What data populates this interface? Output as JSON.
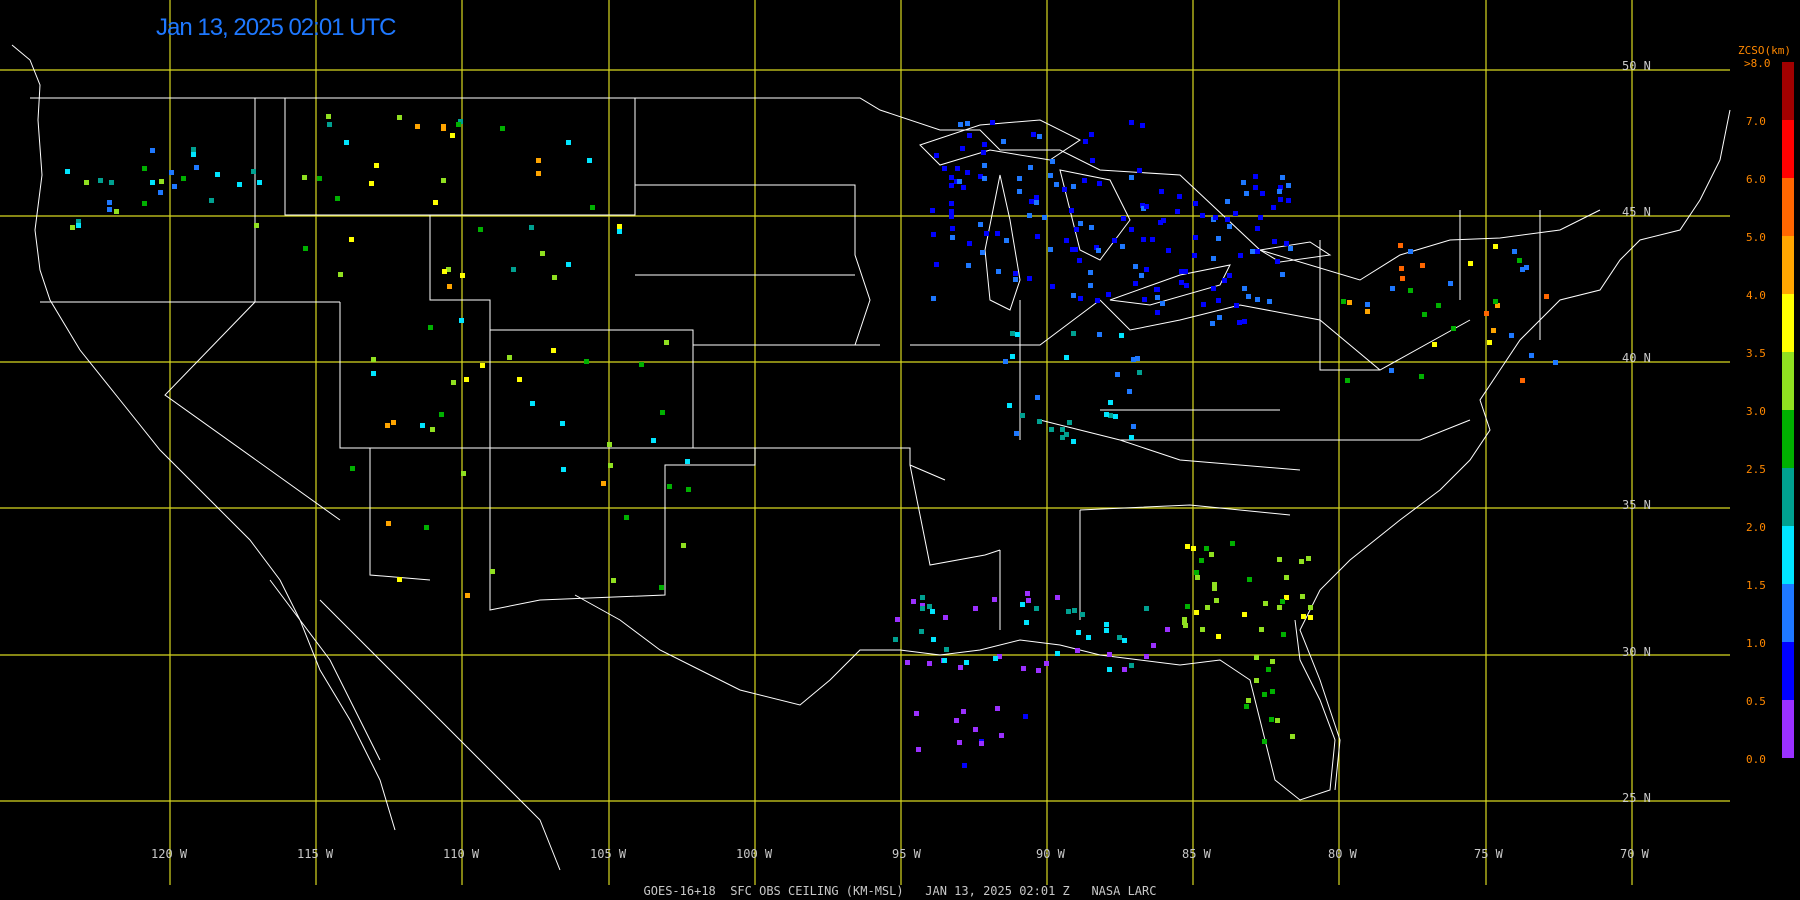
{
  "timestamp": "Jan 13, 2025 02:01 UTC",
  "footer": "GOES-16+18  SFC OBS CEILING (KM-MSL)   JAN 13, 2025 02:01 Z   NASA LARC",
  "latitude_labels": [
    "50 N",
    "45 N",
    "40 N",
    "35 N",
    "30 N",
    "25 N"
  ],
  "longitude_labels": [
    "120 W",
    "115 W",
    "110 W",
    "105 W",
    "100 W",
    "95 W",
    "90 W",
    "85 W",
    "80 W",
    "75 W",
    "70 W"
  ],
  "color_scale": {
    "title": "ZCSO(km)",
    "top_label": ">8.0",
    "ticks": [
      "7.0",
      "6.0",
      "5.0",
      "4.0",
      "3.5",
      "3.0",
      "2.5",
      "2.0",
      "1.5",
      "1.0",
      "0.5",
      "0.0"
    ],
    "colors": [
      "#9b30ff",
      "#0000ff",
      "#1e78ff",
      "#00e5ff",
      "#00a090",
      "#00b000",
      "#90e020",
      "#ffff00",
      "#ffa500",
      "#ff6600",
      "#ff0000",
      "#a00000"
    ]
  },
  "style": {
    "grid_color": "#d8d820",
    "boundary_color": "#ffffff",
    "background": "#000000"
  }
}
